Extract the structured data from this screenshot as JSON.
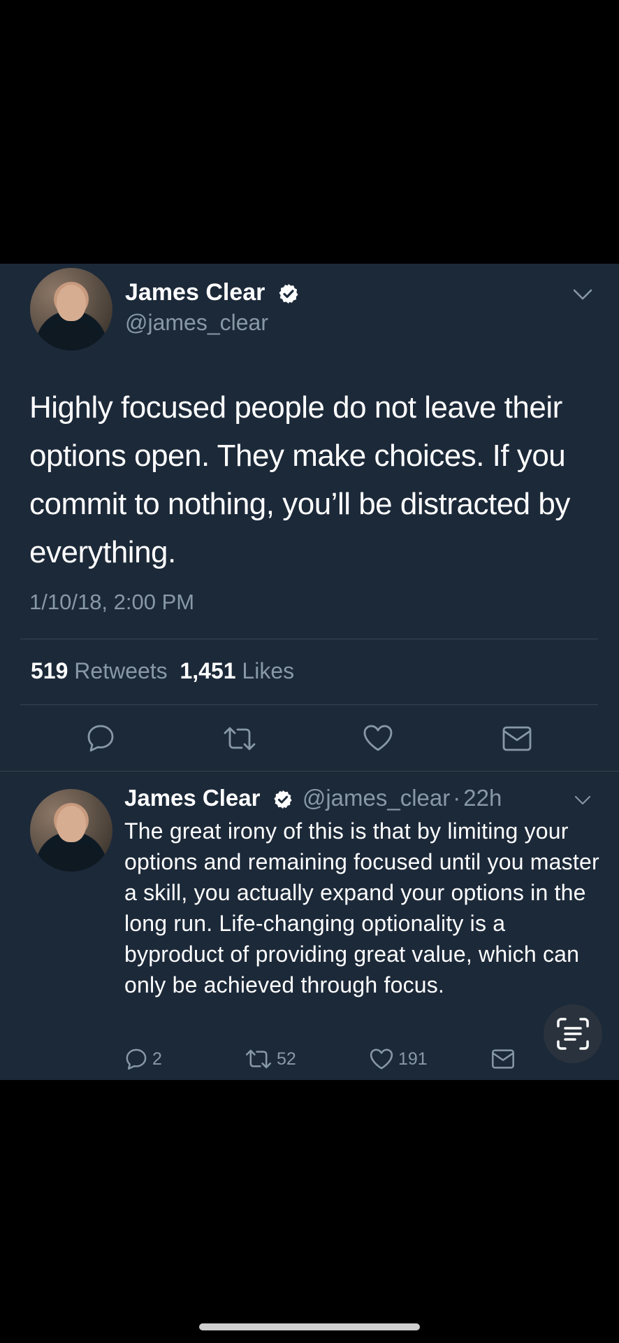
{
  "main_tweet": {
    "author_name": "James Clear",
    "handle": "@james_clear",
    "text": "Highly focused people do not leave their options open. They make choices. If you commit to nothing, you’ll be distracted by everything.",
    "timestamp": "1/10/18, 2:00 PM",
    "retweets_count": "519",
    "retweets_label": "Retweets",
    "likes_count": "1,451",
    "likes_label": "Likes"
  },
  "reply": {
    "author_name": "James Clear",
    "handle": "@james_clear",
    "separator": "·",
    "time_ago": "22h",
    "text": "The great irony of this is that by limiting your options and remaining focused until you master a skill, you actually expand your options in the long run. Life-changing optionality is a byproduct of providing great value, which can only be achieved through focus.",
    "reply_count": "2",
    "retweet_count": "52",
    "like_count": "191"
  },
  "colors": {
    "background": "#000000",
    "card": "#1c2939",
    "secondary_text": "#8899a6",
    "divider": "#38444d"
  },
  "icons": [
    "verified-badge-icon",
    "chevron-down-icon",
    "reply-icon",
    "retweet-icon",
    "like-icon",
    "message-icon",
    "scan-text-icon"
  ]
}
